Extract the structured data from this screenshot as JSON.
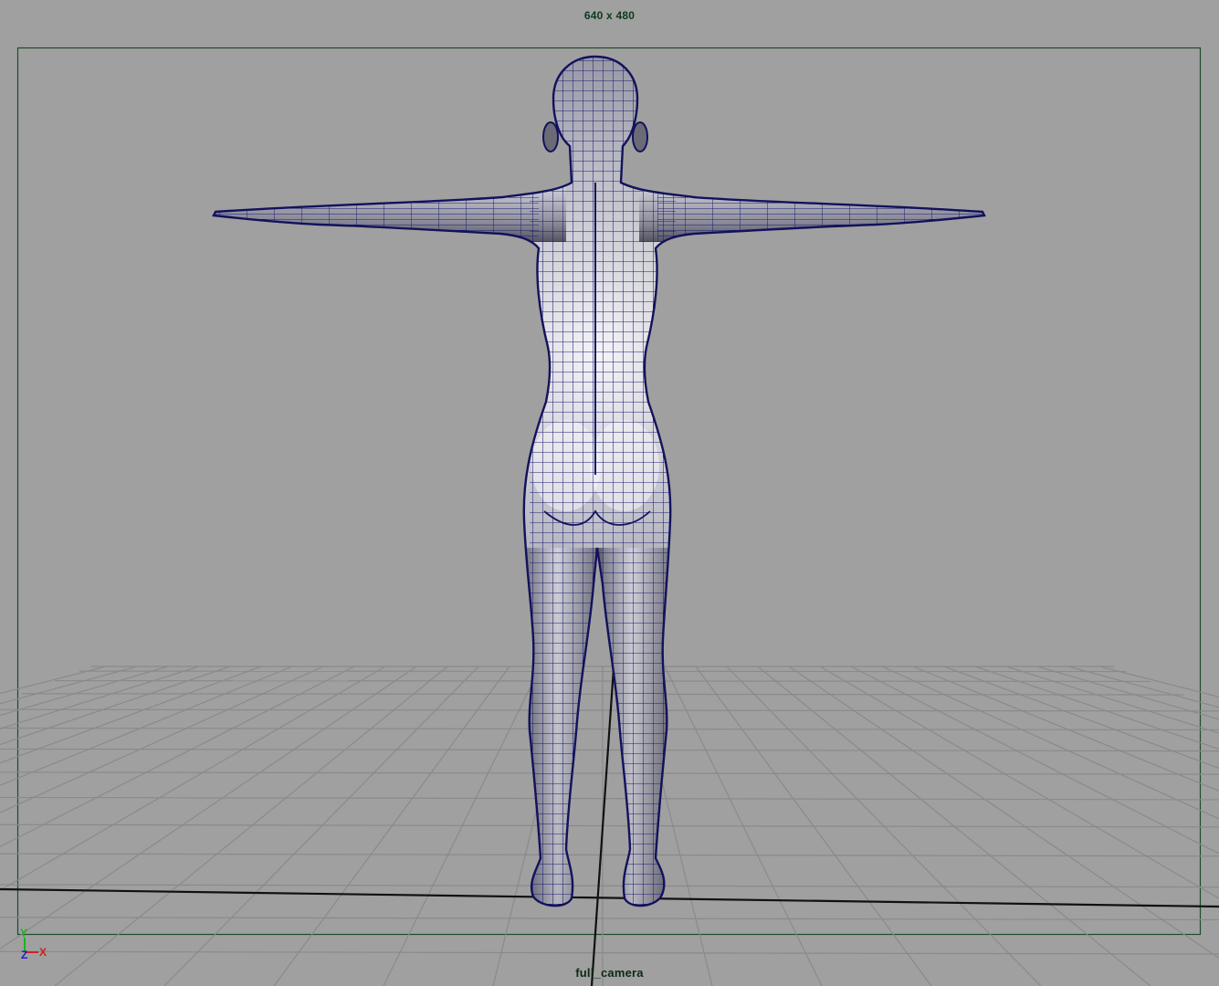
{
  "viewport": {
    "resolution_label": "640 x 480",
    "camera_name": "full_camera",
    "background_color": "#a0a0a0",
    "resolution_gate_color": "#1f4a2a",
    "wireframe_color": "#1a1a6e",
    "mesh_shade_color": "#5b5b66"
  },
  "axis_indicator": {
    "y_label": "Y",
    "z_label": "Z",
    "x_label": "X",
    "y_color": "#19b519",
    "z_color": "#1e1ec8",
    "x_color": "#d21e1e"
  },
  "scene": {
    "object": "character-mesh",
    "pose": "T-pose",
    "view": "back"
  }
}
